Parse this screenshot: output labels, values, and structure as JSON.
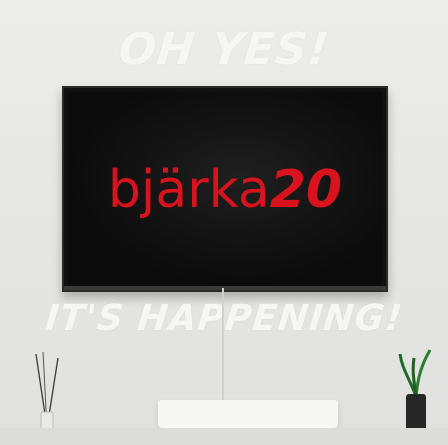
{
  "scene": {
    "headline_top": "OH YES!",
    "headline_bottom": "IT'S HAPPENING!"
  },
  "tv": {
    "brand_text": "bjärka",
    "brand_number": "20",
    "brand_color": "#d8131d"
  },
  "props": {
    "left": "reed-diffuser-icon",
    "right": "plant-pot-icon",
    "center": "media-console"
  }
}
